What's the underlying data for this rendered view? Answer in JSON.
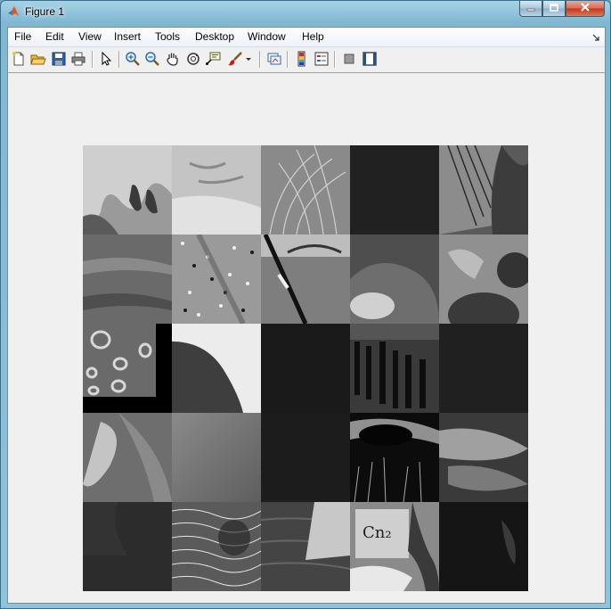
{
  "window": {
    "title": "Figure 1",
    "icon": "matlab-logo-icon",
    "controls": [
      "minimize-icon",
      "maximize-icon",
      "close-icon"
    ]
  },
  "menubar": {
    "items": [
      "File",
      "Edit",
      "View",
      "Insert",
      "Tools",
      "Desktop",
      "Window",
      "Help"
    ]
  },
  "toolbar": {
    "buttons": [
      "new-figure-icon",
      "open-file-icon",
      "save-figure-icon",
      "print-figure-icon",
      "edit-plot-arrow-icon",
      "zoom-in-icon",
      "zoom-out-icon",
      "pan-hand-icon",
      "rotate-3d-icon",
      "data-cursor-icon",
      "brush-icon",
      "brush-dropdown-icon",
      "link-plot-icon",
      "insert-colorbar-icon",
      "insert-legend-icon",
      "hide-plot-tools-icon",
      "show-plot-tools-icon"
    ]
  },
  "figure": {
    "content": "grayscale-texture-mosaic",
    "rows": 5,
    "columns": 5,
    "tiles": [
      {
        "id": "tile-1-1",
        "base": "#8a8a8a"
      },
      {
        "id": "tile-1-2",
        "base": "#bdbdbd"
      },
      {
        "id": "tile-1-3",
        "base": "#9a9a9a"
      },
      {
        "id": "tile-1-4",
        "base": "#1e1e1e"
      },
      {
        "id": "tile-1-5",
        "base": "#6e6e6e"
      },
      {
        "id": "tile-2-1",
        "base": "#6a6a6a"
      },
      {
        "id": "tile-2-2",
        "base": "#808080"
      },
      {
        "id": "tile-2-3",
        "base": "#7a7a7a"
      },
      {
        "id": "tile-2-4",
        "base": "#5a5a5a"
      },
      {
        "id": "tile-2-5",
        "base": "#8c8c8c"
      },
      {
        "id": "tile-3-1",
        "base": "#5a5a5a"
      },
      {
        "id": "tile-3-2",
        "base": "#e6e6e6"
      },
      {
        "id": "tile-3-3",
        "base": "#1a1a1a"
      },
      {
        "id": "tile-3-4",
        "base": "#2e2e2e"
      },
      {
        "id": "tile-3-5",
        "base": "#202020"
      },
      {
        "id": "tile-4-1",
        "base": "#7a7a7a"
      },
      {
        "id": "tile-4-2",
        "base": "#727272"
      },
      {
        "id": "tile-4-3",
        "base": "#1c1c1c"
      },
      {
        "id": "tile-4-4",
        "base": "#0c0c0c"
      },
      {
        "id": "tile-4-5",
        "base": "#555555"
      },
      {
        "id": "tile-5-1",
        "base": "#2c2c2c"
      },
      {
        "id": "tile-5-2",
        "base": "#6a6a6a"
      },
      {
        "id": "tile-5-3",
        "base": "#4a4a4a"
      },
      {
        "id": "tile-5-4",
        "base": "#8a8a8a",
        "text": "Cn₂"
      },
      {
        "id": "tile-5-5",
        "base": "#151515"
      }
    ]
  }
}
